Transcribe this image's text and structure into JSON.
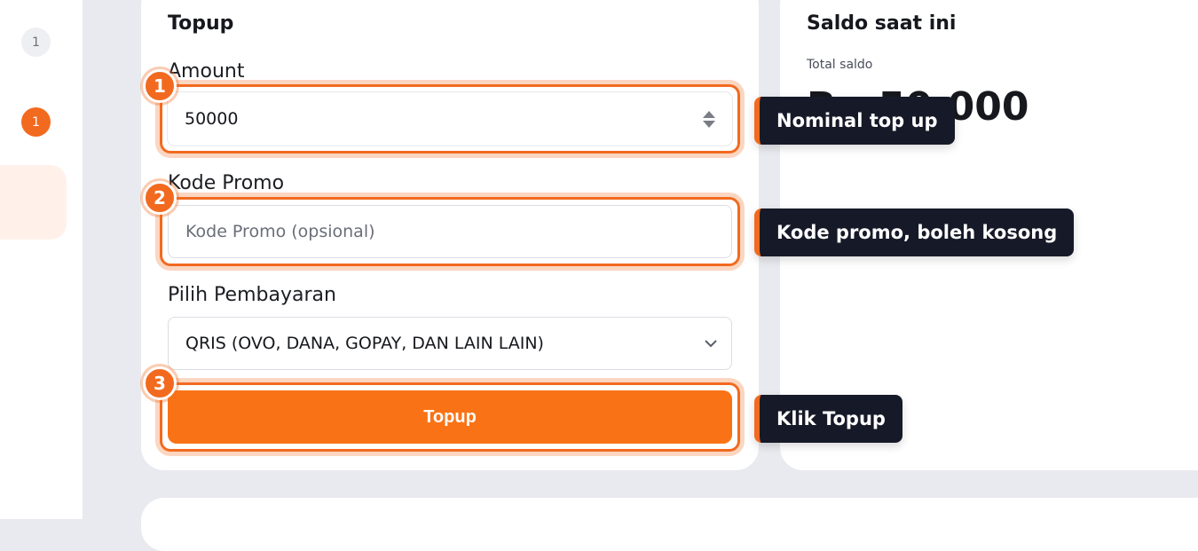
{
  "sidebar": {
    "badges": [
      "1",
      "1"
    ]
  },
  "form": {
    "title": "Topup",
    "amount_label": "Amount",
    "amount_value": "50000",
    "promo_label": "Kode Promo",
    "promo_placeholder": "Kode Promo (opsional)",
    "payment_label": "Pilih Pembayaran",
    "payment_selected": "QRIS (OVO, DANA, GOPAY, DAN LAIN LAIN)",
    "submit_label": "Topup"
  },
  "balance": {
    "title": "Saldo saat ini",
    "total_label": "Total saldo",
    "amount": "Rp 50.000"
  },
  "tour": {
    "steps": [
      {
        "number": "1",
        "tooltip": "Nominal top up"
      },
      {
        "number": "2",
        "tooltip": "Kode promo, boleh kosong"
      },
      {
        "number": "3",
        "tooltip": "Klik Topup"
      }
    ]
  },
  "colors": {
    "accent": "#f97316",
    "tooltip_bg": "#161a28",
    "page_bg": "#e9eaef"
  },
  "icons": {
    "spinner": "number-spinner-icon",
    "dropdown": "chevron-down-icon"
  }
}
